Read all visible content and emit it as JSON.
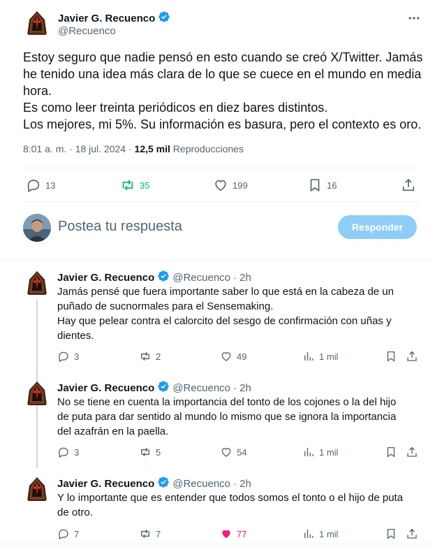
{
  "main_tweet": {
    "author": {
      "name": "Javier G. Recuenco",
      "handle": "@Recuenco"
    },
    "text_lines": [
      "Estoy seguro que nadie pensó en esto cuando se creó X/Twitter. Jamás",
      "he tenido una idea más clara de lo que se cuece en el mundo en media",
      "hora.",
      "Es como leer treinta periódicos en diez bares distintos.",
      "Los mejores, mi 5%. Su información es basura, pero el contexto es oro."
    ],
    "time": "8:01 a. m. · 18 jul. 2024 · ",
    "views_count": "12,5 mil",
    "views_label": " Reproducciones",
    "stats": {
      "replies": "13",
      "reposts": "35",
      "likes": "199",
      "bookmarks": "16"
    }
  },
  "composer": {
    "placeholder": "Postea tu respuesta",
    "button_label": "Responder"
  },
  "replies": [
    {
      "name": "Javier G. Recuenco",
      "handle": "@Recuenco",
      "time": "· 2h",
      "text_lines": [
        "Jamás pensé que fuera importante saber lo que está en la cabeza de un",
        "puñado de sucnormales para el Sensemaking.",
        "Hay que pelear contra el calorcito del sesgo de confirmación con uñas y",
        "dientes."
      ],
      "stats": {
        "replies": "3",
        "reposts": "2",
        "likes": "49",
        "views": "1 mil"
      }
    },
    {
      "name": "Javier G. Recuenco",
      "handle": "@Recuenco",
      "time": "· 2h",
      "text_lines": [
        "No se tiene en cuenta la importancia del tonto de los cojones o la del hijo",
        "de puta para dar sentido al mundo lo mismo que se ignora la importancia",
        "del azafrán en la paella."
      ],
      "stats": {
        "replies": "3",
        "reposts": "5",
        "likes": "54",
        "views": "1 mil"
      }
    },
    {
      "name": "Javier G. Recuenco",
      "handle": "@Recuenco",
      "time": "· 2h",
      "text_lines": [
        "Y lo importante que es entender que todos somos el tonto o el hijo de puta",
        "de otro."
      ],
      "stats": {
        "replies": "7",
        "reposts": "7",
        "likes": "77",
        "views": "1 mil"
      }
    }
  ],
  "colors": {
    "verified": "#1d9bf0",
    "repost_active": "#00ba7c",
    "like_active": "#f91880",
    "reply_button": "#8ecdf7",
    "muted": "#536471"
  },
  "icons": [
    "verified-badge-icon",
    "more-icon",
    "reply-icon",
    "repost-icon",
    "like-icon",
    "bookmark-icon",
    "share-icon",
    "views-icon"
  ]
}
